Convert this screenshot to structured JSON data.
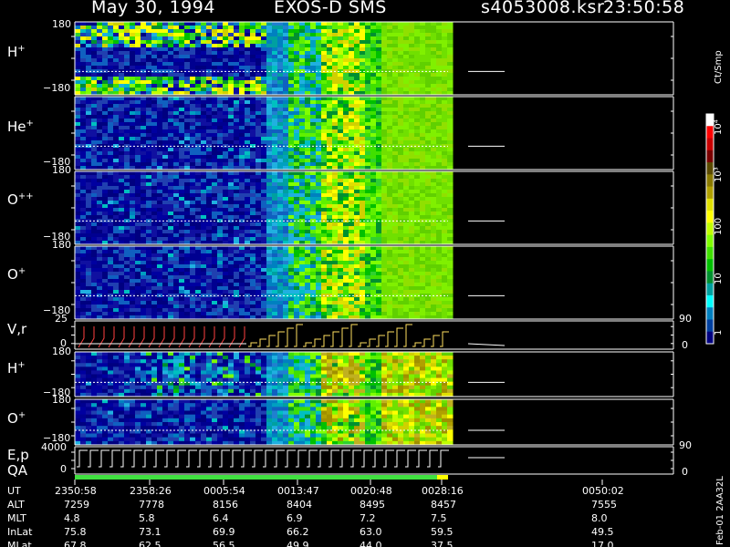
{
  "header": {
    "date": "May 30, 1994",
    "instrument": "EXOS-D SMS",
    "file": "s4053008.ksr",
    "time": "23:50:58"
  },
  "panels": [
    {
      "label": "H",
      "sup": "+",
      "ymax": "180",
      "ymin": "−180"
    },
    {
      "label": "He",
      "sup": "+",
      "ymax": "",
      "ymin": "−180"
    },
    {
      "label": "O",
      "sup": "++",
      "ymax": "180",
      "ymin": "−180"
    },
    {
      "label": "O",
      "sup": "+",
      "ymax": "180",
      "ymin": "−180"
    },
    {
      "label": "V,r",
      "sup": "",
      "ymax": "25",
      "ymin": "0",
      "rmax": "90",
      "rmin": "0"
    },
    {
      "label": "H",
      "sup": "+",
      "ymax": "180",
      "ymin": "−180"
    },
    {
      "label": "O",
      "sup": "+",
      "ymax": "180",
      "ymin": "−180"
    },
    {
      "label": "E,p",
      "sup": "",
      "ymax": "4000",
      "ymin": "0",
      "rmax": "90",
      "rmin": "0"
    }
  ],
  "qa_label": "QA",
  "colorbar": {
    "unit": "Ct/Smp",
    "labels": [
      "10⁴",
      "10³",
      "100",
      "10",
      "1"
    ],
    "colors": [
      "#ffffff",
      "#ff0000",
      "#c80000",
      "#7a0000",
      "#5a4a00",
      "#8a7a00",
      "#b0a000",
      "#e0e000",
      "#ffff00",
      "#c0ff00",
      "#80ff00",
      "#40e000",
      "#00c000",
      "#009030",
      "#00a0a0",
      "#00ffff",
      "#0080c0",
      "#0040a0",
      "#000080"
    ]
  },
  "footer_side": "Feb-01 2AA32L",
  "ephemeris": {
    "labels": [
      "UT",
      "ALT",
      "MLT",
      "InLat",
      "MLat"
    ],
    "columns": [
      [
        "2350:58",
        "7259",
        "4.8",
        "75.8",
        "67.8"
      ],
      [
        "2358:26",
        "7778",
        "5.8",
        "73.1",
        "62.5"
      ],
      [
        "0005:54",
        "8156",
        "6.4",
        "69.9",
        "56.5"
      ],
      [
        "0013:47",
        "8404",
        "6.9",
        "66.2",
        "49.9"
      ],
      [
        "0020:48",
        "8495",
        "7.2",
        "63.0",
        "44.0"
      ],
      [
        "0028:16",
        "8457",
        "7.5",
        "59.5",
        "37.5"
      ],
      [
        "0050:02",
        "7555",
        "8.0",
        "49.5",
        "17.0"
      ]
    ]
  },
  "chart_data": {
    "type": "heatmap",
    "title": "May 30, 1994   EXOS-D SMS",
    "x": [
      "2350:58",
      "2358:26",
      "0005:54",
      "0013:47",
      "0020:48",
      "0028:16",
      "0050:02"
    ],
    "panels": [
      "H+",
      "He+",
      "O++",
      "O+",
      "V,r",
      "H+",
      "O+",
      "E,p"
    ],
    "colorbar": {
      "label": "Ct/Smp",
      "range": [
        1,
        10000
      ],
      "scale": "log"
    }
  }
}
